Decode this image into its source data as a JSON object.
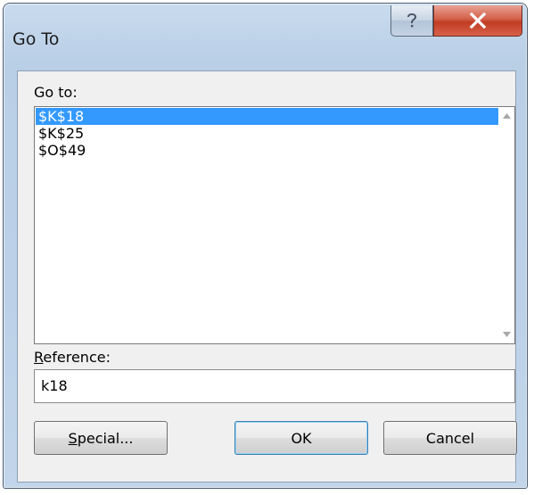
{
  "window": {
    "title": "Go To",
    "help_icon": "question-mark-icon",
    "close_icon": "close-x-icon"
  },
  "goto": {
    "label": "Go to:",
    "items": [
      {
        "text": "$K$18",
        "selected": true
      },
      {
        "text": "$K$25",
        "selected": false
      },
      {
        "text": "$O$49",
        "selected": false
      }
    ]
  },
  "reference": {
    "label_first": "R",
    "label_rest": "eference:",
    "value": "k18"
  },
  "buttons": {
    "special_first": "S",
    "special_rest": "pecial...",
    "ok": "OK",
    "cancel": "Cancel"
  },
  "colors": {
    "selection": "#3399ff",
    "close_button": "#c03c22"
  }
}
